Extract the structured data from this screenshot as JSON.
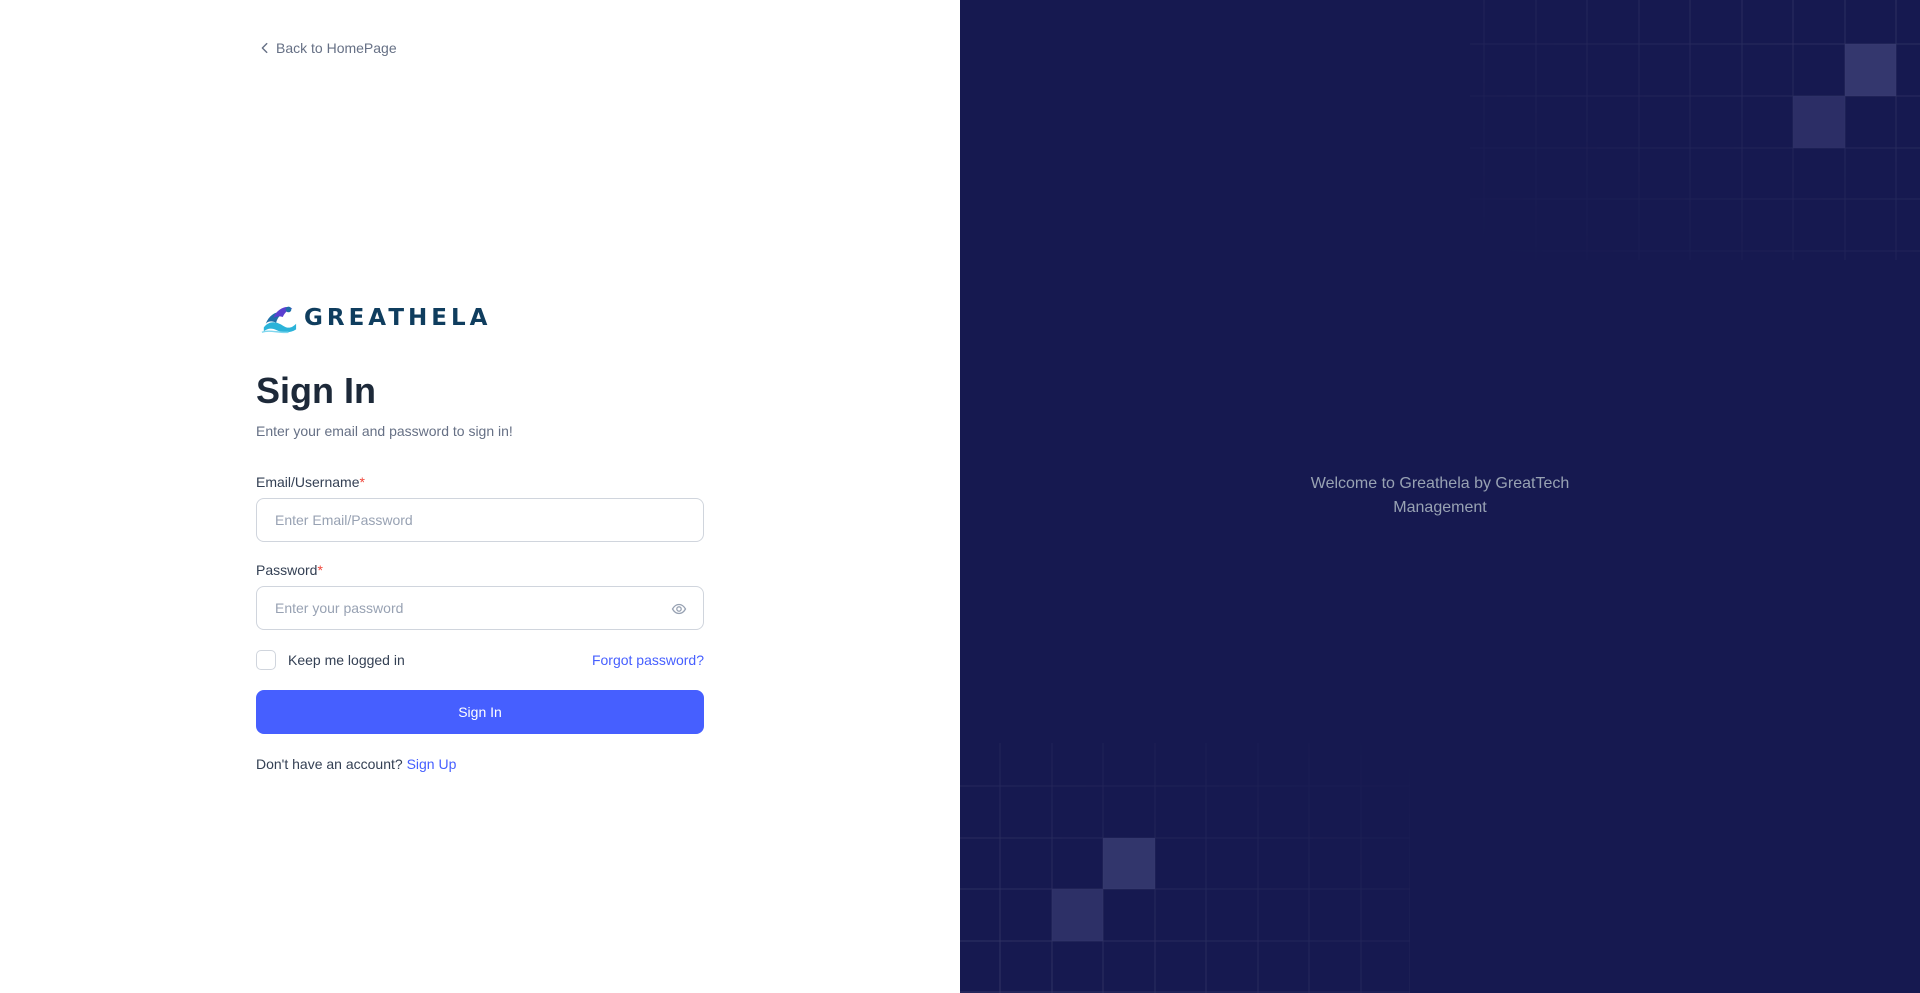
{
  "back_link": {
    "label": "Back to HomePage"
  },
  "logo": {
    "text": "GREATHELA"
  },
  "form": {
    "title": "Sign In",
    "subtitle": "Enter your email and password to sign in!",
    "email": {
      "label": "Email/Username",
      "required_mark": "*",
      "placeholder": "Enter Email/Password",
      "value": ""
    },
    "password": {
      "label": "Password",
      "required_mark": "*",
      "placeholder": "Enter your password",
      "value": ""
    },
    "remember_label": "Keep me logged in",
    "forgot_label": "Forgot password?",
    "submit_label": "Sign In",
    "no_account_text": "Don't have an account?",
    "signup_label": "Sign Up"
  },
  "right_panel": {
    "welcome_line1": "Welcome to Greathela by GreatTech",
    "welcome_line2": "Management"
  },
  "colors": {
    "primary": "#465fff",
    "panel_bg": "#161950",
    "required": "#f04438"
  }
}
